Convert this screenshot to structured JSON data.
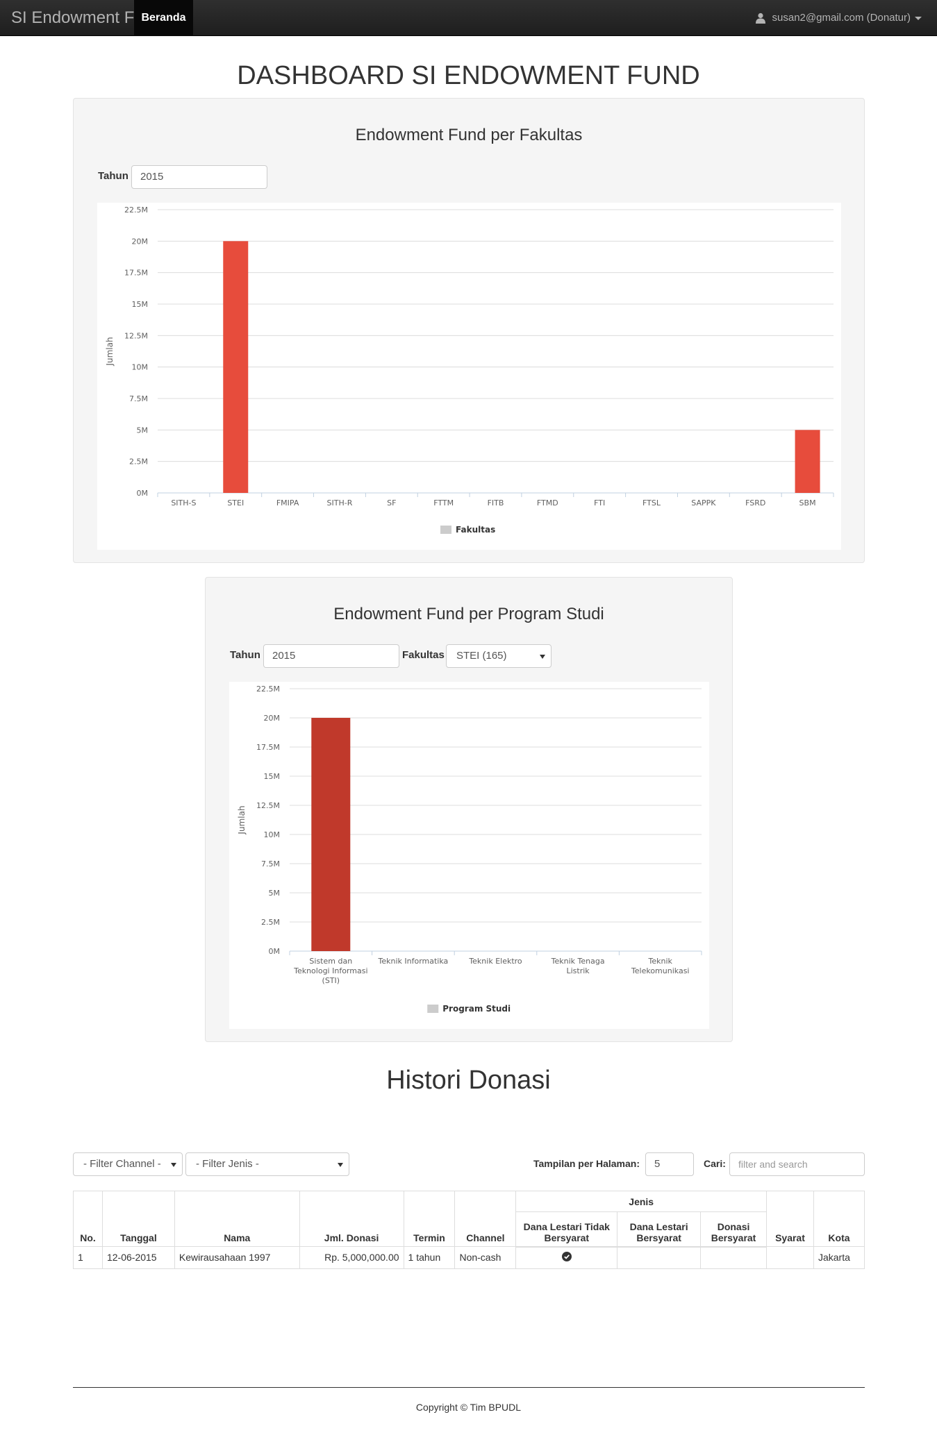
{
  "navbar": {
    "brand": "SI Endowment Fund",
    "active_item": "Beranda",
    "user": "susan2@gmail.com (Donatur)"
  },
  "page_title": "DASHBOARD SI ENDOWMENT FUND",
  "panel1": {
    "title": "Endowment Fund per Fakultas",
    "tahun_label": "Tahun",
    "tahun_value": "2015"
  },
  "panel2": {
    "title": "Endowment Fund per Program Studi",
    "tahun_label": "Tahun",
    "tahun_value": "2015",
    "fakultas_label": "Fakultas",
    "fakultas_value": "STEI (165)"
  },
  "chart_data": [
    {
      "type": "bar",
      "ylabel": "Jumlah",
      "ylim": [
        0,
        22500000
      ],
      "yticks": [
        "0M",
        "2.5M",
        "5M",
        "7.5M",
        "10M",
        "12.5M",
        "15M",
        "17.5M",
        "20M",
        "22.5M"
      ],
      "categories": [
        "SITH-S",
        "STEI",
        "FMIPA",
        "SITH-R",
        "SF",
        "FTTM",
        "FITB",
        "FTMD",
        "FTI",
        "FTSL",
        "SAPPK",
        "FSRD",
        "SBM"
      ],
      "values": [
        0,
        20000000,
        0,
        0,
        0,
        0,
        0,
        0,
        0,
        0,
        0,
        0,
        5000000
      ],
      "legend": "Fakultas",
      "color": "#e74c3c"
    },
    {
      "type": "bar",
      "ylabel": "Jumlah",
      "ylim": [
        0,
        22500000
      ],
      "yticks": [
        "0M",
        "2.5M",
        "5M",
        "7.5M",
        "10M",
        "12.5M",
        "15M",
        "17.5M",
        "20M",
        "22.5M"
      ],
      "categories": [
        [
          "Sistem dan",
          "Teknologi Informasi",
          "(STI)"
        ],
        [
          "Teknik Informatika"
        ],
        [
          "Teknik Elektro"
        ],
        [
          "Teknik Tenaga",
          "Listrik"
        ],
        [
          "Teknik",
          "Telekomunikasi"
        ]
      ],
      "values": [
        20000000,
        0,
        0,
        0,
        0
      ],
      "legend": "Program Studi",
      "color": "#c0392b"
    }
  ],
  "history": {
    "title": "Histori Donasi",
    "filter_channel": "- Filter Channel -",
    "filter_jenis": "- Filter Jenis -",
    "per_page_label": "Tampilan per Halaman:",
    "per_page_value": "5",
    "search_label": "Cari:",
    "search_placeholder": "filter and search",
    "headers": {
      "no": "No.",
      "tanggal": "Tanggal",
      "nama": "Nama",
      "jml": "Jml. Donasi",
      "termin": "Termin",
      "channel": "Channel",
      "jenis": "Jenis",
      "dana_lestari_tidak": "Dana Lestari Tidak Bersyarat",
      "dana_lestari": "Dana Lestari Bersyarat",
      "donasi_bersyarat": "Donasi Bersyarat",
      "syarat": "Syarat",
      "kota": "Kota"
    },
    "rows": [
      {
        "no": "1",
        "tanggal": "12-06-2015",
        "nama": "Kewirausahaan 1997",
        "jml": "Rp. 5,000,000.00",
        "termin": "1 tahun",
        "channel": "Non-cash",
        "dana_lestari_tidak": "check-circle-icon",
        "kota": "Jakarta"
      }
    ]
  },
  "footer": "Copyright © Tim BPUDL"
}
